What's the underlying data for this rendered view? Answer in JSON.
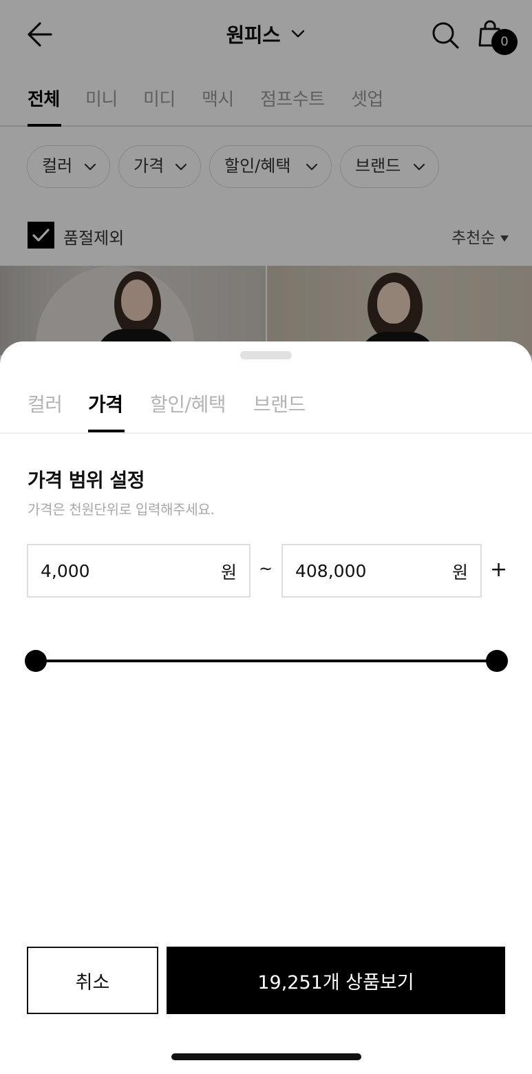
{
  "header": {
    "title": "원피스",
    "cart_count": "0"
  },
  "category_tabs": [
    {
      "label": "전체",
      "active": true
    },
    {
      "label": "미니",
      "active": false
    },
    {
      "label": "미디",
      "active": false
    },
    {
      "label": "맥시",
      "active": false
    },
    {
      "label": "점프수트",
      "active": false
    },
    {
      "label": "셋업",
      "active": false
    }
  ],
  "filter_chips": [
    {
      "label": "컬러"
    },
    {
      "label": "가격"
    },
    {
      "label": "할인/혜택"
    },
    {
      "label": "브랜드"
    }
  ],
  "soldout_toggle": {
    "label": "품절제외",
    "checked": true
  },
  "sort": {
    "label": "추천순"
  },
  "sheet": {
    "tabs": [
      {
        "label": "컬러",
        "active": false
      },
      {
        "label": "가격",
        "active": true
      },
      {
        "label": "할인/혜택",
        "active": false
      },
      {
        "label": "브랜드",
        "active": false
      }
    ],
    "section_title": "가격 범위 설정",
    "hint": "가격은 천원단위로 입력해주세요.",
    "price_min": "4,000",
    "price_max": "408,000",
    "unit": "원",
    "range_separator": "~",
    "max_suffix": "+",
    "slider": {
      "min_fraction": 0,
      "max_fraction": 1
    },
    "cancel_label": "취소",
    "view_label": "19,251개 상품보기"
  },
  "colors": {
    "accent": "#000000",
    "muted_text": "#9a9a9a",
    "border": "#dedede"
  }
}
